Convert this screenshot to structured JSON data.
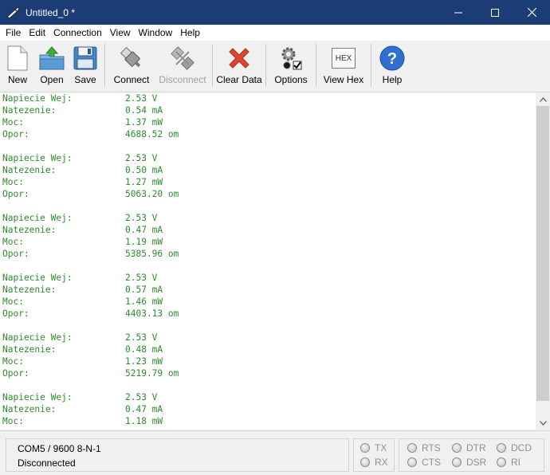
{
  "window": {
    "title": "Untitled_0 *"
  },
  "menu": [
    "File",
    "Edit",
    "Connection",
    "View",
    "Window",
    "Help"
  ],
  "toolbar": {
    "new": "New",
    "open": "Open",
    "save": "Save",
    "connect": "Connect",
    "disconnect": "Disconnect",
    "clear": "Clear Data",
    "options": "Options",
    "viewhex": "View Hex",
    "hex_icon_text": "HEX",
    "help": "Help"
  },
  "terminal": {
    "lines": [
      [
        "Napiecie Wej:",
        "2.53 V"
      ],
      [
        "Natezenie:",
        "0.54 mA"
      ],
      [
        "Moc:",
        "1.37 mW"
      ],
      [
        "Opor:",
        "4688.52 om"
      ],
      [
        "",
        ""
      ],
      [
        "Napiecie Wej:",
        "2.53 V"
      ],
      [
        "Natezenie:",
        "0.50 mA"
      ],
      [
        "Moc:",
        "1.27 mW"
      ],
      [
        "Opor:",
        "5063.20 om"
      ],
      [
        "",
        ""
      ],
      [
        "Napiecie Wej:",
        "2.53 V"
      ],
      [
        "Natezenie:",
        "0.47 mA"
      ],
      [
        "Moc:",
        "1.19 mW"
      ],
      [
        "Opor:",
        "5385.96 om"
      ],
      [
        "",
        ""
      ],
      [
        "Napiecie Wej:",
        "2.53 V"
      ],
      [
        "Natezenie:",
        "0.57 mA"
      ],
      [
        "Moc:",
        "1.46 mW"
      ],
      [
        "Opor:",
        "4403.13 om"
      ],
      [
        "",
        ""
      ],
      [
        "Napiecie Wej:",
        "2.53 V"
      ],
      [
        "Natezenie:",
        "0.48 mA"
      ],
      [
        "Moc:",
        "1.23 mW"
      ],
      [
        "Opor:",
        "5219.79 om"
      ],
      [
        "",
        ""
      ],
      [
        "Napiecie Wej:",
        "2.53 V"
      ],
      [
        "Natezenie:",
        "0.47 mA"
      ],
      [
        "Moc:",
        "1.18 mW"
      ]
    ]
  },
  "status": {
    "port": "COM5 / 9600 8-N-1",
    "state": "Disconnected",
    "leds": {
      "tx": "TX",
      "rx": "RX",
      "rts": "RTS",
      "cts": "CTS",
      "dtr": "DTR",
      "dsr": "DSR",
      "dcd": "DCD",
      "ri": "RI"
    }
  },
  "colors": {
    "titlebar": "#1c3c75",
    "terminal_text": "#2e8b2e"
  }
}
